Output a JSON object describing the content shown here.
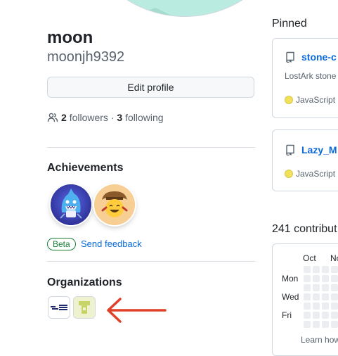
{
  "profile": {
    "display_name": "moon",
    "username": "moonjh9392",
    "edit_profile_label": "Edit profile",
    "followers_count": "2",
    "followers_label": "followers",
    "separator": "·",
    "following_count": "3",
    "following_label": "following"
  },
  "achievements": {
    "title": "Achievements",
    "badges": [
      "shark-badge",
      "cowboy-emoji-badge"
    ],
    "beta_label": "Beta",
    "feedback_label": "Send feedback"
  },
  "organizations": {
    "title": "Organizations",
    "items": [
      "org-logo-1",
      "org-logo-2"
    ]
  },
  "pinned": {
    "title": "Pinned",
    "repos": [
      {
        "name": "stone-c",
        "description": "LostArk stone",
        "language": "JavaScript",
        "language_color": "#f1e05a"
      },
      {
        "name": "Lazy_M",
        "description": "",
        "language": "JavaScript",
        "language_color": "#f1e05a"
      }
    ]
  },
  "contributions": {
    "title": "241 contribut",
    "months": [
      "Oct",
      "No"
    ],
    "days": [
      "Mon",
      "Wed",
      "Fri"
    ],
    "learn_label": "Learn how"
  },
  "colors": {
    "link": "#0969da",
    "beta_green": "#1a7f37",
    "annotation_arrow": "#e0402a",
    "empty_cell": "#ebedf0"
  }
}
